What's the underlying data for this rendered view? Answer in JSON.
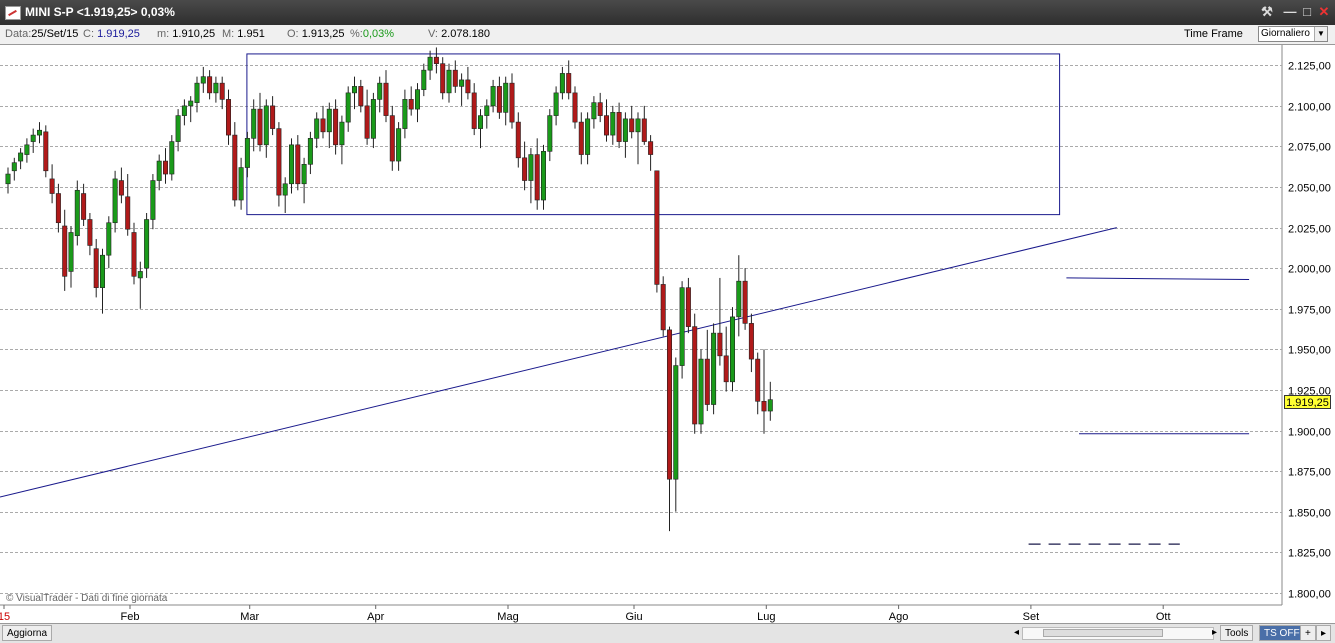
{
  "window": {
    "title": "MINI S-P <1.919,25> 0,03%",
    "buttons": {
      "tool": "⚒",
      "minimize": "—",
      "maximize": "□",
      "close": "✕"
    }
  },
  "info": {
    "data_label": "Data:",
    "data_value": "25/Set/15",
    "close_label": "C:",
    "close_value": "1.919,25",
    "min_label": "m:",
    "min_value": "1.910,25",
    "max_label": "M:",
    "max_value": "1.951",
    "open_label": "O:",
    "open_value": "1.913,25",
    "pct_label": "%:",
    "pct_value": "0,03%",
    "vol_label": "V:",
    "vol_value": "2.078.180",
    "timeframe_label": "Time Frame",
    "timeframe_value": "Giornaliero"
  },
  "colors": {
    "up": "#1a9a1a",
    "down": "#b01a1a",
    "trendline": "#1a1a8c",
    "grid": "#aaaaaa",
    "price_tag": "#ffff33"
  },
  "watermark": "© VisualTrader - Dati di fine giornata",
  "last_price": "1.919,25",
  "bottom": {
    "refresh": "Aggiorna",
    "tools": "Tools",
    "ts": "TS OFF",
    "plus": "+",
    "arrow": "▸"
  },
  "chart_data": {
    "type": "candlestick",
    "y_ticks": [
      "2.125,00",
      "2.100,00",
      "2.075,00",
      "2.050,00",
      "2.025,00",
      "2.000,00",
      "1.975,00",
      "1.950,00",
      "1.925,00",
      "1.900,00",
      "1.875,00",
      "1.850,00",
      "1.825,00",
      "1.800,00"
    ],
    "ylim": [
      1795,
      2140
    ],
    "x_labels": [
      "15",
      "Feb",
      "Mar",
      "Apr",
      "Mag",
      "Giu",
      "Lug",
      "Ago",
      "Set",
      "Ott"
    ],
    "x_label_index": [
      0,
      20,
      39,
      59,
      80,
      100,
      121,
      142,
      163,
      184
    ],
    "candles": [
      [
        2052,
        2062,
        2046,
        2058
      ],
      [
        2060,
        2068,
        2054,
        2065
      ],
      [
        2066,
        2074,
        2061,
        2071
      ],
      [
        2070,
        2080,
        2065,
        2076
      ],
      [
        2078,
        2086,
        2071,
        2082
      ],
      [
        2082,
        2090,
        2077,
        2085
      ],
      [
        2084,
        2088,
        2056,
        2060
      ],
      [
        2055,
        2064,
        2040,
        2046
      ],
      [
        2046,
        2052,
        2022,
        2028
      ],
      [
        2026,
        2036,
        1986,
        1995
      ],
      [
        1998,
        2026,
        1988,
        2022
      ],
      [
        2020,
        2054,
        2014,
        2048
      ],
      [
        2046,
        2052,
        2026,
        2030
      ],
      [
        2030,
        2034,
        2008,
        2014
      ],
      [
        2012,
        2018,
        1982,
        1988
      ],
      [
        1988,
        2012,
        1972,
        2008
      ],
      [
        2008,
        2032,
        2000,
        2028
      ],
      [
        2028,
        2060,
        2022,
        2055
      ],
      [
        2054,
        2062,
        2040,
        2045
      ],
      [
        2044,
        2058,
        2020,
        2024
      ],
      [
        2022,
        2028,
        1990,
        1995
      ],
      [
        1994,
        2004,
        1975,
        1998
      ],
      [
        2000,
        2034,
        1994,
        2030
      ],
      [
        2030,
        2058,
        2024,
        2054
      ],
      [
        2054,
        2070,
        2048,
        2066
      ],
      [
        2066,
        2074,
        2052,
        2058
      ],
      [
        2058,
        2082,
        2054,
        2078
      ],
      [
        2078,
        2098,
        2072,
        2094
      ],
      [
        2094,
        2104,
        2088,
        2100
      ],
      [
        2100,
        2106,
        2090,
        2103
      ],
      [
        2102,
        2118,
        2096,
        2114
      ],
      [
        2114,
        2124,
        2108,
        2118
      ],
      [
        2118,
        2122,
        2104,
        2108
      ],
      [
        2108,
        2118,
        2102,
        2114
      ],
      [
        2114,
        2118,
        2098,
        2104
      ],
      [
        2104,
        2110,
        2076,
        2082
      ],
      [
        2082,
        2090,
        2038,
        2042
      ],
      [
        2042,
        2068,
        2036,
        2062
      ],
      [
        2062,
        2084,
        2056,
        2080
      ],
      [
        2080,
        2104,
        2072,
        2098
      ],
      [
        2098,
        2108,
        2072,
        2076
      ],
      [
        2076,
        2104,
        2068,
        2100
      ],
      [
        2100,
        2106,
        2082,
        2086
      ],
      [
        2086,
        2090,
        2038,
        2045
      ],
      [
        2045,
        2056,
        2034,
        2052
      ],
      [
        2052,
        2080,
        2046,
        2076
      ],
      [
        2076,
        2082,
        2048,
        2052
      ],
      [
        2052,
        2068,
        2040,
        2064
      ],
      [
        2064,
        2084,
        2058,
        2080
      ],
      [
        2080,
        2096,
        2074,
        2092
      ],
      [
        2092,
        2100,
        2080,
        2084
      ],
      [
        2084,
        2102,
        2074,
        2098
      ],
      [
        2098,
        2104,
        2070,
        2076
      ],
      [
        2076,
        2094,
        2064,
        2090
      ],
      [
        2090,
        2112,
        2084,
        2108
      ],
      [
        2108,
        2118,
        2098,
        2112
      ],
      [
        2112,
        2116,
        2096,
        2100
      ],
      [
        2100,
        2110,
        2076,
        2080
      ],
      [
        2080,
        2108,
        2074,
        2104
      ],
      [
        2104,
        2118,
        2096,
        2114
      ],
      [
        2114,
        2122,
        2090,
        2094
      ],
      [
        2094,
        2100,
        2060,
        2066
      ],
      [
        2066,
        2090,
        2060,
        2086
      ],
      [
        2086,
        2110,
        2080,
        2104
      ],
      [
        2104,
        2112,
        2094,
        2098
      ],
      [
        2098,
        2114,
        2090,
        2110
      ],
      [
        2110,
        2126,
        2106,
        2122
      ],
      [
        2122,
        2134,
        2116,
        2130
      ],
      [
        2130,
        2136,
        2120,
        2126
      ],
      [
        2126,
        2130,
        2104,
        2108
      ],
      [
        2108,
        2126,
        2102,
        2122
      ],
      [
        2122,
        2128,
        2108,
        2112
      ],
      [
        2112,
        2120,
        2100,
        2116
      ],
      [
        2116,
        2124,
        2104,
        2108
      ],
      [
        2108,
        2114,
        2082,
        2086
      ],
      [
        2086,
        2098,
        2074,
        2094
      ],
      [
        2094,
        2104,
        2086,
        2100
      ],
      [
        2100,
        2116,
        2096,
        2112
      ],
      [
        2112,
        2118,
        2092,
        2096
      ],
      [
        2096,
        2118,
        2088,
        2114
      ],
      [
        2114,
        2120,
        2086,
        2090
      ],
      [
        2090,
        2096,
        2062,
        2068
      ],
      [
        2068,
        2078,
        2048,
        2054
      ],
      [
        2054,
        2074,
        2040,
        2070
      ],
      [
        2070,
        2080,
        2036,
        2042
      ],
      [
        2042,
        2076,
        2036,
        2072
      ],
      [
        2072,
        2098,
        2066,
        2094
      ],
      [
        2094,
        2112,
        2088,
        2108
      ],
      [
        2108,
        2124,
        2104,
        2120
      ],
      [
        2120,
        2128,
        2104,
        2108
      ],
      [
        2108,
        2112,
        2086,
        2090
      ],
      [
        2090,
        2096,
        2064,
        2070
      ],
      [
        2070,
        2096,
        2064,
        2092
      ],
      [
        2092,
        2106,
        2086,
        2102
      ],
      [
        2102,
        2108,
        2090,
        2094
      ],
      [
        2094,
        2104,
        2078,
        2082
      ],
      [
        2082,
        2100,
        2076,
        2096
      ],
      [
        2096,
        2102,
        2074,
        2078
      ],
      [
        2078,
        2096,
        2068,
        2092
      ],
      [
        2092,
        2100,
        2080,
        2084
      ],
      [
        2084,
        2096,
        2064,
        2092
      ],
      [
        2092,
        2100,
        2076,
        2078
      ],
      [
        2078,
        2082,
        2060,
        2070
      ],
      [
        2060,
        2045,
        1985,
        1990
      ],
      [
        1990,
        1995,
        1958,
        1962
      ],
      [
        1962,
        1964,
        1838,
        1870
      ],
      [
        1870,
        1945,
        1850,
        1940
      ],
      [
        1940,
        1992,
        1932,
        1988
      ],
      [
        1988,
        1994,
        1960,
        1964
      ],
      [
        1964,
        1972,
        1898,
        1904
      ],
      [
        1904,
        1950,
        1898,
        1944
      ],
      [
        1944,
        1962,
        1912,
        1916
      ],
      [
        1916,
        1966,
        1910,
        1960
      ],
      [
        1960,
        1994,
        1940,
        1946
      ],
      [
        1946,
        1964,
        1924,
        1930
      ],
      [
        1930,
        1976,
        1924,
        1970
      ],
      [
        1970,
        2008,
        1958,
        1992
      ],
      [
        1992,
        2000,
        1962,
        1966
      ],
      [
        1966,
        1972,
        1936,
        1944
      ],
      [
        1944,
        1948,
        1910,
        1918
      ],
      [
        1918,
        1950,
        1898,
        1912
      ],
      [
        1912,
        1930,
        1906,
        1919
      ]
    ],
    "box_range": [
      2033,
      2132
    ],
    "support": 1898,
    "resistance": 1994,
    "dashed_level": 1830
  }
}
